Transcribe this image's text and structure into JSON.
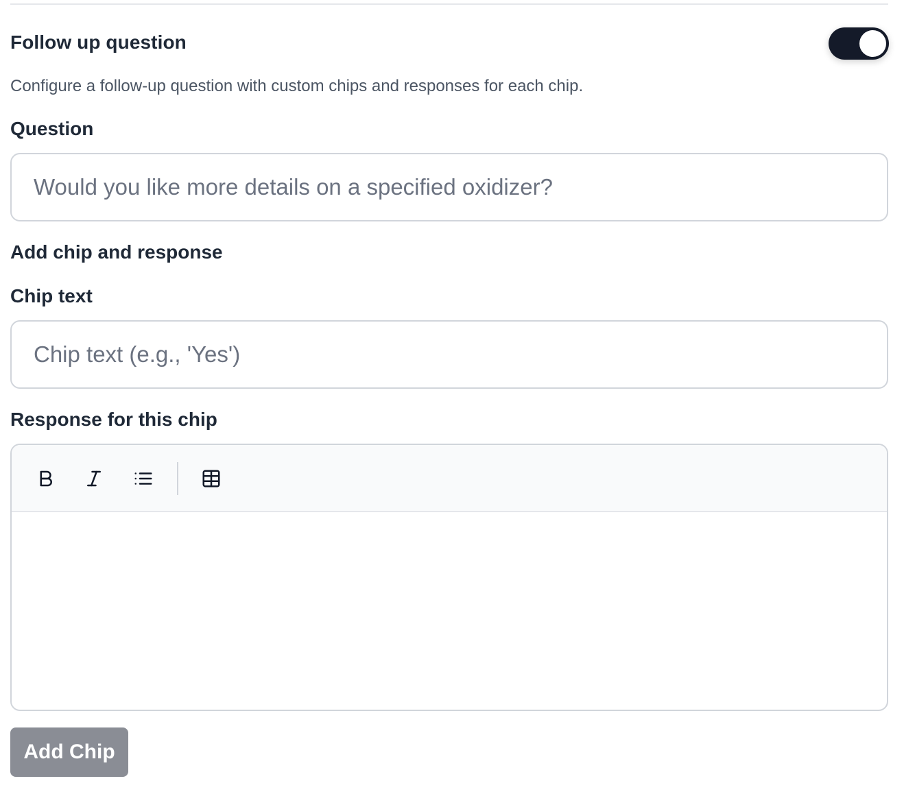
{
  "follow_up": {
    "title": "Follow up question",
    "toggle_enabled": true,
    "description": "Configure a follow-up question with custom chips and responses for each chip."
  },
  "question": {
    "label": "Question",
    "placeholder": "Would you like more details on a specified oxidizer?",
    "value": ""
  },
  "add_chip_section": {
    "title": "Add chip and response"
  },
  "chip_text": {
    "label": "Chip text",
    "placeholder": "Chip text (e.g., 'Yes')",
    "value": ""
  },
  "response": {
    "label": "Response for this chip",
    "toolbar": [
      {
        "name": "bold-icon",
        "action": "bold"
      },
      {
        "name": "italic-icon",
        "action": "italic"
      },
      {
        "name": "bullet-list-icon",
        "action": "bullet list"
      },
      {
        "name": "table-icon",
        "action": "table"
      }
    ],
    "content": ""
  },
  "add_chip_button": {
    "label": "Add Chip"
  },
  "colors": {
    "toggle_on": "#141a29",
    "button_disabled": "#8a8d95",
    "border": "#d1d5db",
    "toolbar_bg": "#f9fafb"
  }
}
